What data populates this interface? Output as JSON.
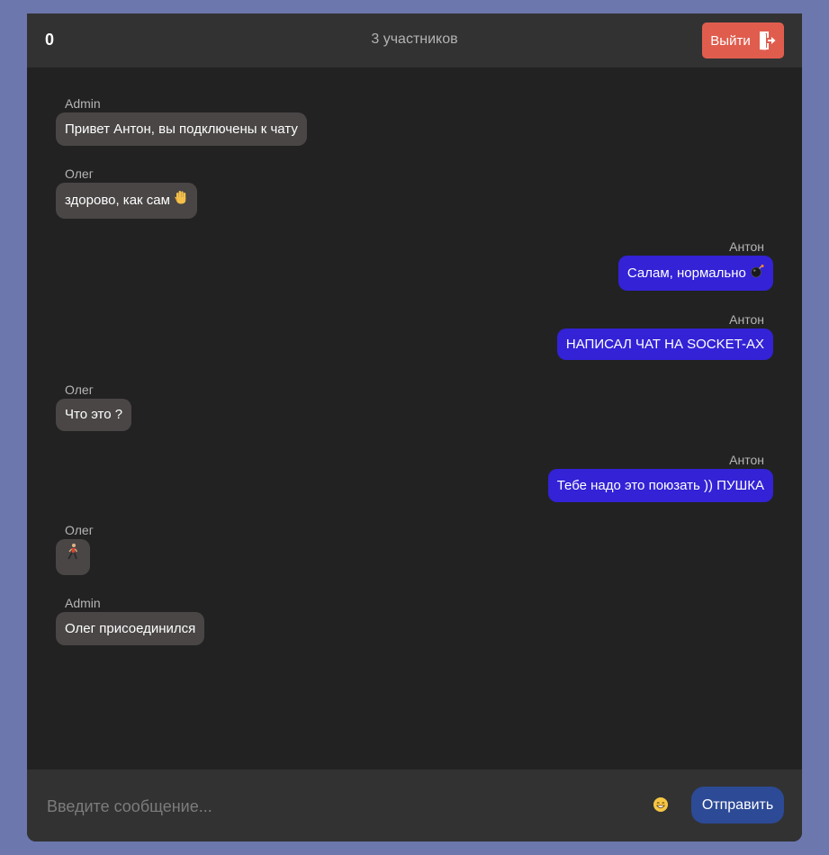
{
  "header": {
    "count": "0",
    "members": "3 участников",
    "exit_label": "Выйти",
    "exit_icon": "door-exit-icon"
  },
  "messages": [
    {
      "side": "left",
      "author": "Admin",
      "text": "Привет Антон, вы подключены к чату"
    },
    {
      "side": "left",
      "author": "Олег",
      "text": "здорово, как сам",
      "emoji": "waving-hand-icon"
    },
    {
      "side": "right",
      "author": "Антон",
      "text": "Салам, нормально",
      "emoji": "bomb-icon"
    },
    {
      "side": "right",
      "author": "Антон",
      "text": "НАПИСАЛ ЧАТ НА SOCKET-АХ"
    },
    {
      "side": "left",
      "author": "Олег",
      "text": "Что это ?"
    },
    {
      "side": "right",
      "author": "Антон",
      "text": "Тебе надо это поюзать )) ПУШКА"
    },
    {
      "side": "left",
      "author": "Олег",
      "text": "",
      "emoji": "person-walking-icon"
    },
    {
      "side": "left",
      "author": "Admin",
      "text": "Олег присоединился"
    }
  ],
  "composer": {
    "placeholder": "Введите сообщение...",
    "value": "",
    "emoji_icon": "smiley-face-icon",
    "send_label": "Отправить"
  },
  "colors": {
    "page_background": "#6b77ad",
    "chat_background": "#222222",
    "header_background": "#323232",
    "incoming_bubble": "#4a4646",
    "outgoing_bubble": "#3322d6",
    "exit_button": "#e05d4e",
    "send_button": "#2c4a96"
  }
}
